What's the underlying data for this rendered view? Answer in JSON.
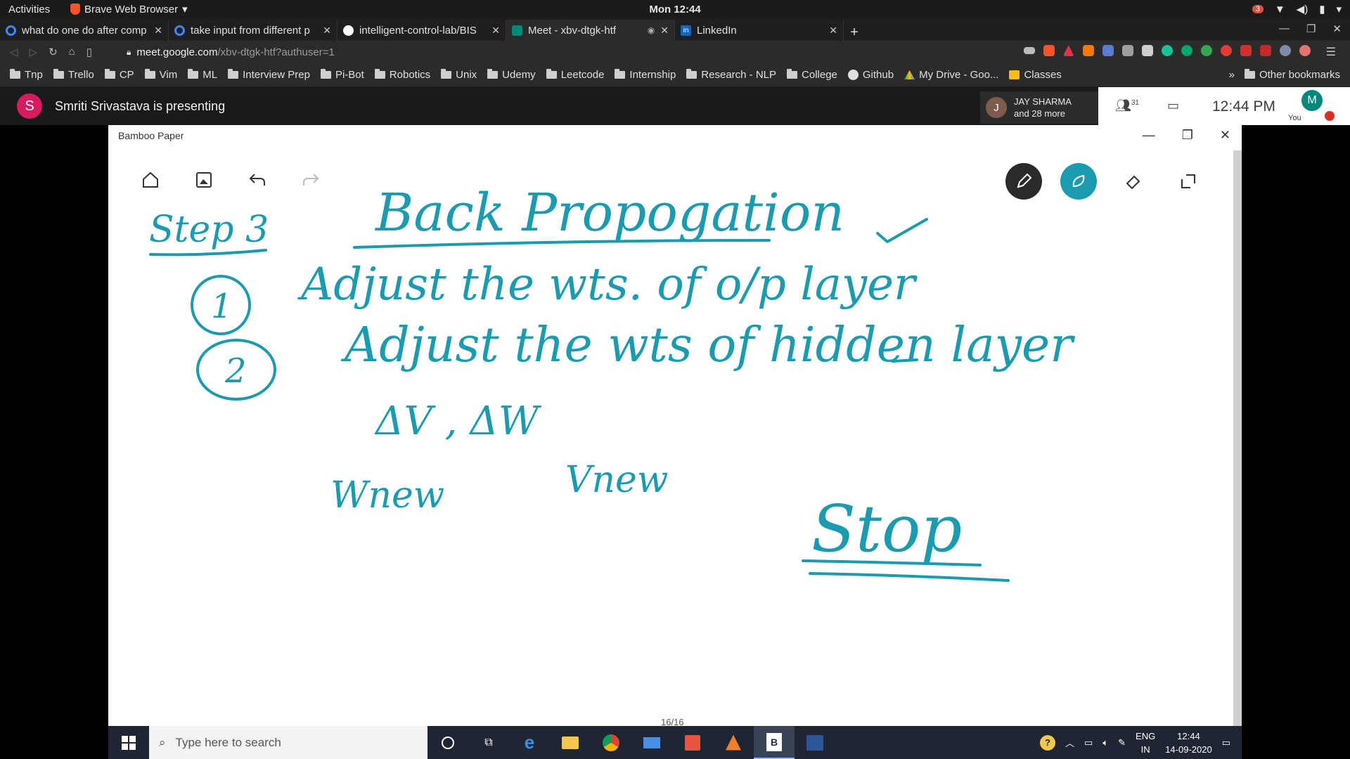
{
  "ubuntu": {
    "activities": "Activities",
    "app_name": "Brave Web Browser",
    "clock": "Mon 12:44",
    "notification_count": "3"
  },
  "tabs": [
    {
      "title": "what do one do after comp",
      "icon": "google-icon",
      "color": "#4285f4"
    },
    {
      "title": "take input from different p",
      "icon": "google-icon",
      "color": "#4285f4"
    },
    {
      "title": "intelligent-control-lab/BIS",
      "icon": "github-icon",
      "color": "#ffffff"
    },
    {
      "title": "Meet - xbv-dtgk-htf",
      "icon": "meet-icon",
      "color": "#00897b",
      "active": true
    },
    {
      "title": "LinkedIn",
      "icon": "linkedin-icon",
      "color": "#0a66c2"
    }
  ],
  "address": {
    "host": "meet.google.com",
    "path": "/xbv-dtgk-htf?authuser=1"
  },
  "bookmarks": [
    "Tnp",
    "Trello",
    "CP",
    "Vim",
    "ML",
    "Interview Prep",
    "Pi-Bot",
    "Robotics",
    "Unix",
    "Udemy",
    "Leetcode",
    "Internship",
    "Research - NLP",
    "College",
    "Github",
    "My Drive - Goo...",
    "Classes"
  ],
  "bookmarks_overflow": "»",
  "other_bookmarks": "Other bookmarks",
  "meet": {
    "presenter_initial": "S",
    "presenter_text": "Smriti Srivastava is presenting",
    "participant_initial": "J",
    "participant_name": "JAY SHARMA",
    "participant_more": "and 28 more",
    "people_count": "31",
    "time": "12:44 PM",
    "you_initial": "M",
    "you_label": "You"
  },
  "bamboo": {
    "window_title": "Bamboo Paper",
    "page_indicator": "16/16",
    "ink_color": "#1a9bb0"
  },
  "handwriting": {
    "heading": "Step 3",
    "title": "Back Propogation",
    "item1_num": "1",
    "item1_text": "Adjust the wts. of o/p layer",
    "item2_num": "2",
    "item2_text": "Adjust the wts of hidden layer",
    "deltas": "ΔV , ΔW",
    "wnew": "Wnew",
    "vnew": "Vnew",
    "stop": "Stop"
  },
  "taskbar": {
    "search_placeholder": "Type here to search",
    "lang_top": "ENG",
    "lang_bottom": "IN",
    "time": "12:44",
    "date": "14-09-2020"
  }
}
